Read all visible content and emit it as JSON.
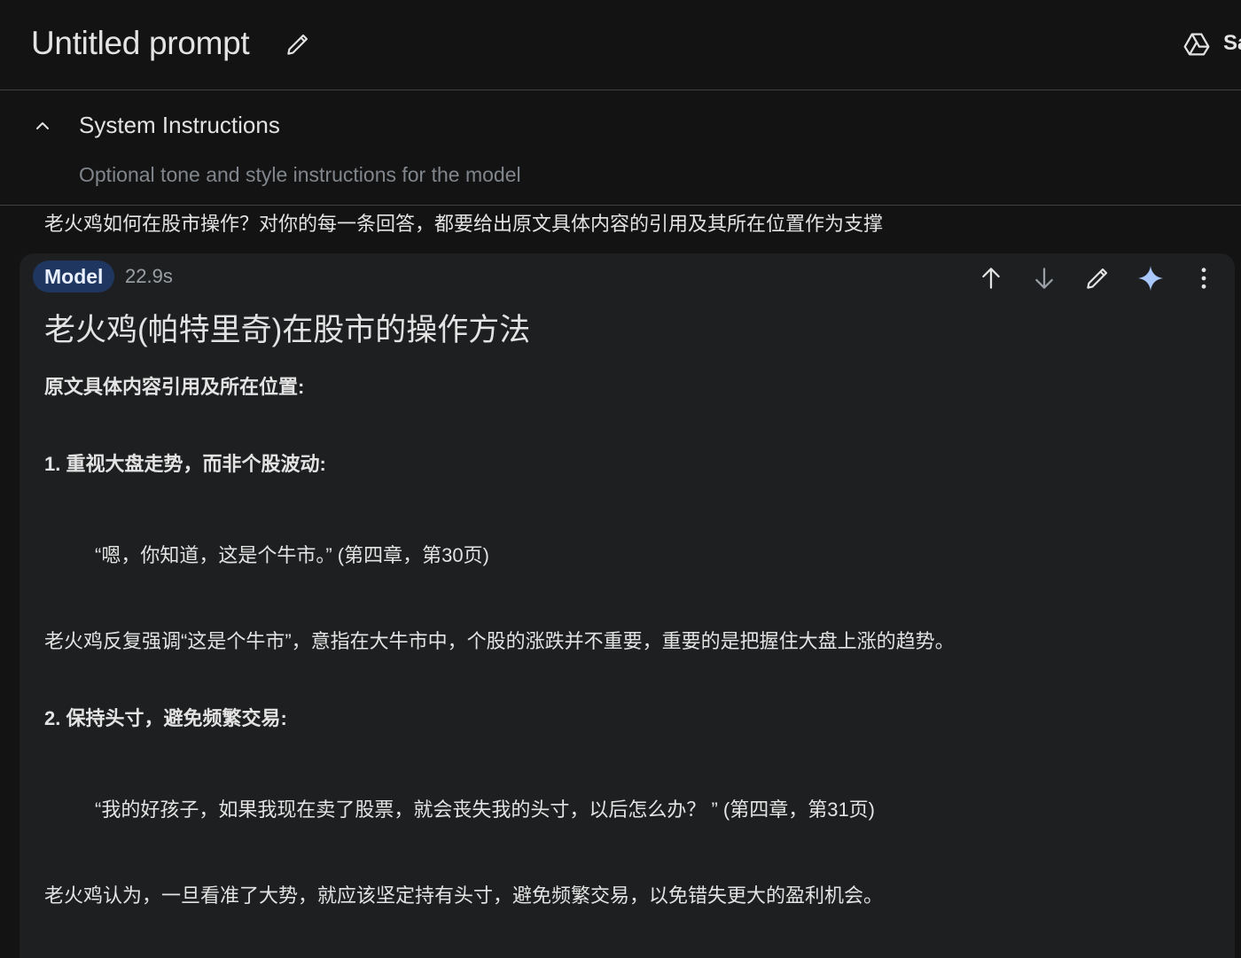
{
  "header": {
    "title": "Untitled prompt",
    "save_label": "Sa"
  },
  "system_instructions": {
    "title": "System Instructions",
    "placeholder": "Optional tone and style instructions for the model"
  },
  "user_message": "老火鸡如何在股市操作？对你的每一条回答，都要给出原文具体内容的引用及其所在位置作为支撑",
  "model_response": {
    "badge": "Model",
    "time": "22.9s",
    "heading": "老火鸡(帕特里奇)在股市的操作方法",
    "intro": "原文具体内容引用及所在位置:",
    "point1_title": "1. 重视大盘走势，而非个股波动:",
    "point1_quote": "“嗯，你知道，这是个牛市。” (第四章，第30页)",
    "point1_explain": "老火鸡反复强调“这是个牛市”，意指在大牛市中，个股的涨跌并不重要，重要的是把握住大盘上涨的趋势。",
    "point2_title": "2. 保持头寸，避免频繁交易:",
    "point2_quote": "“我的好孩子，如果我现在卖了股票，就会丧失我的头寸，以后怎么办？ ” (第四章，第31页)",
    "point2_explain": "老火鸡认为，一旦看准了大势，就应该坚定持有头寸，避免频繁交易，以免错失更大的盈利机会。"
  },
  "icons": {
    "edit_title": "pencil-icon",
    "drive": "drive-icon",
    "collapse": "chevron-up-icon",
    "move_up": "arrow-up-icon",
    "move_down": "arrow-down-icon",
    "edit": "pencil-icon",
    "gemini": "sparkle-icon",
    "more": "more-vert-icon"
  },
  "colors": {
    "background": "#131314",
    "card": "#1e1f20",
    "badge_bg": "#1f3760",
    "sparkle": "#a8c7fa"
  }
}
